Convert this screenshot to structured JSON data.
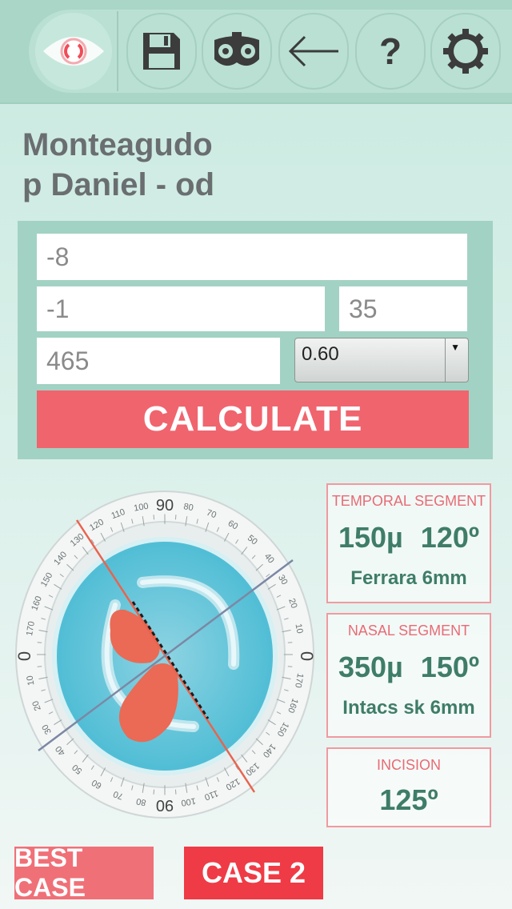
{
  "toolbar": {
    "items": [
      {
        "icon": "eye-logo-icon"
      },
      {
        "icon": "save-icon"
      },
      {
        "icon": "phoropter-icon"
      },
      {
        "icon": "arrow-left-icon"
      },
      {
        "icon": "help-icon",
        "label": "?"
      },
      {
        "icon": "gear-icon"
      }
    ]
  },
  "patient": {
    "line1": "Monteagudo",
    "line2": "p Daniel - od"
  },
  "form": {
    "sphere": "-8",
    "cylinder": "-1",
    "axis": "35",
    "pachymetry": "465",
    "select_value": "0.60",
    "calculate_label": "CALCULATE"
  },
  "dial": {
    "labels": [
      "90",
      "0",
      "0",
      "90"
    ],
    "scale_top_left": [
      "80",
      "70",
      "60",
      "50",
      "40",
      "30",
      "20",
      "10"
    ],
    "scale_top_right": [
      "100",
      "110",
      "120",
      "130",
      "140",
      "150",
      "160",
      "170"
    ],
    "scale_bottom_left": [
      "10",
      "20",
      "30",
      "40",
      "50",
      "60",
      "70",
      "80"
    ],
    "scale_bottom_right": [
      "100",
      "110",
      "120",
      "130",
      "140",
      "150",
      "160",
      "170"
    ]
  },
  "cards": {
    "temporal": {
      "title": "TEMPORAL SEGMENT",
      "thickness": "150µ",
      "arc": "120º",
      "ring": "Ferrara 6mm"
    },
    "nasal": {
      "title": "NASAL SEGMENT",
      "thickness": "350µ",
      "arc": "150º",
      "ring": "Intacs sk 6mm"
    },
    "incision": {
      "title": "INCISION",
      "value": "125º"
    }
  },
  "colors": {
    "accent": "#f0646e",
    "active_case": "#ef3b46",
    "teal_text": "#3f7d68",
    "panel": "#a2d2c3"
  },
  "buttons": {
    "best_case": "BEST CASE",
    "case2": "CASE 2"
  }
}
